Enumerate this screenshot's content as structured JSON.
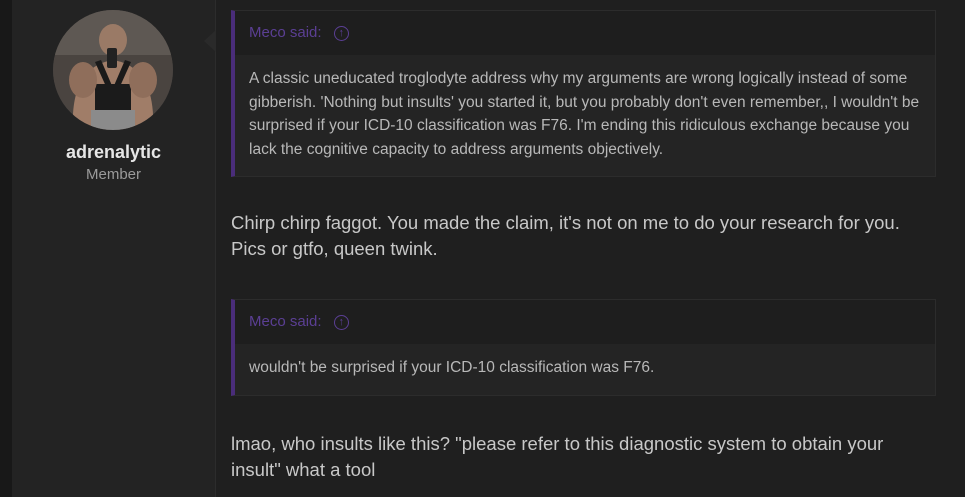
{
  "user": {
    "name": "adrenalytic",
    "title": "Member"
  },
  "quotes": [
    {
      "author_label": "Meco said:",
      "text": "A classic uneducated troglodyte address why my arguments are wrong logically instead of some gibberish. 'Nothing but insults' you started it, but you probably don't even remember,, I wouldn't be surprised if your ICD-10 classification was F76. I'm ending this ridiculous exchange because you lack the cognitive capacity to address arguments objectively."
    },
    {
      "author_label": "Meco said:",
      "text": "wouldn't be surprised if your ICD-10 classification was F76."
    }
  ],
  "messages": [
    "Chirp chirp faggot. You made the claim, it's not on me to do your research for you. Pics or gtfo, queen twink.",
    "lmao, who insults like this? \"please refer to this diagnostic system to obtain your insult\" what a tool"
  ],
  "colors": {
    "quote_accent": "#4a2d7a",
    "quote_author": "#5b3f94"
  },
  "icons": {
    "quote_jump": "arrow-up-circle-icon"
  }
}
